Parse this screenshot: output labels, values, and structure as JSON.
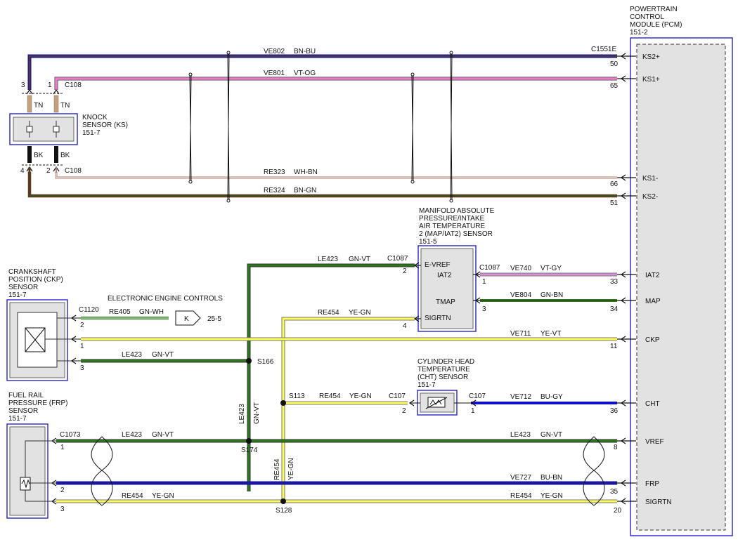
{
  "pcm": {
    "title_lines": [
      "POWERTRAIN",
      "CONTROL",
      "MODULE (PCM)",
      "151-2"
    ],
    "connector": "C1551E",
    "pins": {
      "ks2p": "KS2+",
      "ks1p": "KS1+",
      "ks1m": "KS1-",
      "ks2m": "KS2-",
      "iat2": "IAT2",
      "map": "MAP",
      "ckp": "CKP",
      "cht": "CHT",
      "vref": "VREF",
      "frp": "FRP",
      "sigrtn": "SIGRTN"
    }
  },
  "knock_sensor": {
    "label_lines": [
      "KNOCK",
      "SENSOR (KS)",
      "151-7"
    ],
    "pin3": "3",
    "pin1": "1",
    "pin4": "4",
    "pin2": "2",
    "conn_top": "C108",
    "conn_bot": "C108",
    "tn": "TN",
    "bk": "BK"
  },
  "map_sensor": {
    "label_lines": [
      "MANIFOLD ABSOLUTE",
      "PRESSURE/INTAKE",
      "AIR TEMPERATURE",
      "2 (MAP/IAT2) SENSOR",
      "151-5"
    ],
    "evref": "E-VREF",
    "iat2": "IAT2",
    "tmap": "TMAP",
    "sigrtn": "SIGRTN",
    "conn_left": "C1087",
    "conn_right": "C1087",
    "pin_evref": "2",
    "pin_iat2": "1",
    "pin_tmap": "3",
    "pin_sigrtn": "4"
  },
  "ckp_sensor": {
    "label_lines": [
      "CRANKSHAFT",
      "POSITION (CKP)",
      "SENSOR",
      "151-7"
    ],
    "connector": "C1120",
    "pin2": "2",
    "pin1": "1",
    "pin3": "3"
  },
  "eec": {
    "title": "ELECTRONIC ENGINE CONTROLS",
    "k": "K",
    "ref": "25-5"
  },
  "cht_sensor": {
    "label_lines": [
      "CYLINDER HEAD",
      "TEMPERATURE",
      "(CHT) SENSOR",
      "151-7"
    ],
    "conn_left": "C107",
    "conn_right": "C107",
    "pin2": "2",
    "pin1": "1"
  },
  "frp_sensor": {
    "label_lines": [
      "FUEL RAIL",
      "PRESSURE (FRP)",
      "SENSOR",
      "151-7"
    ],
    "connector": "C1073",
    "pin1": "1",
    "pin2": "2",
    "pin3": "3"
  },
  "splices": {
    "s166": "S166",
    "s174": "S174",
    "s113": "S113",
    "s128": "S128"
  },
  "wires": {
    "ve802": {
      "circuit": "VE802",
      "color": "BN-BU",
      "pin": "50"
    },
    "ve801": {
      "circuit": "VE801",
      "color": "VT-OG",
      "pin": "65"
    },
    "re323": {
      "circuit": "RE323",
      "color": "WH-BN",
      "pin": "66"
    },
    "re324": {
      "circuit": "RE324",
      "color": "BN-GN",
      "pin": "51"
    },
    "le423_map": {
      "circuit": "LE423",
      "color": "GN-VT"
    },
    "ve740": {
      "circuit": "VE740",
      "color": "VT-GY",
      "pin": "33"
    },
    "ve804": {
      "circuit": "VE804",
      "color": "GN-BN",
      "pin": "34"
    },
    "re405": {
      "circuit": "RE405",
      "color": "GN-WH"
    },
    "re454_map": {
      "circuit": "RE454",
      "color": "YE-GN"
    },
    "ve711": {
      "circuit": "VE711",
      "color": "YE-VT",
      "pin": "11"
    },
    "le423_ckp": {
      "circuit": "LE423",
      "color": "GN-VT"
    },
    "re454_cht": {
      "circuit": "RE454",
      "color": "YE-GN"
    },
    "ve712": {
      "circuit": "VE712",
      "color": "BU-GY",
      "pin": "36"
    },
    "le423_frp": {
      "circuit": "LE423",
      "color": "GN-VT"
    },
    "le423_pcm": {
      "circuit": "LE423",
      "color": "GN-VT",
      "pin": "8"
    },
    "ve727": {
      "circuit": "VE727",
      "color": "BU-BN",
      "pin": "35"
    },
    "re454_frp": {
      "circuit": "RE454",
      "color": "YE-GN"
    },
    "re454_pcm": {
      "circuit": "RE454",
      "color": "YE-GN",
      "pin": "20"
    },
    "vert_le423": {
      "circuit": "LE423",
      "color": "GN-VT"
    },
    "vert_re454": {
      "circuit": "RE454",
      "color": "YE-GN"
    }
  },
  "colors": {
    "brown": "#5a3a1e",
    "blue": "#1010c8",
    "violet": "#e070c0",
    "green": "#2a7a1a",
    "yellow": "#ffff55",
    "tan": "#c8a078",
    "black": "#111111",
    "module_border": "#3333cc"
  }
}
